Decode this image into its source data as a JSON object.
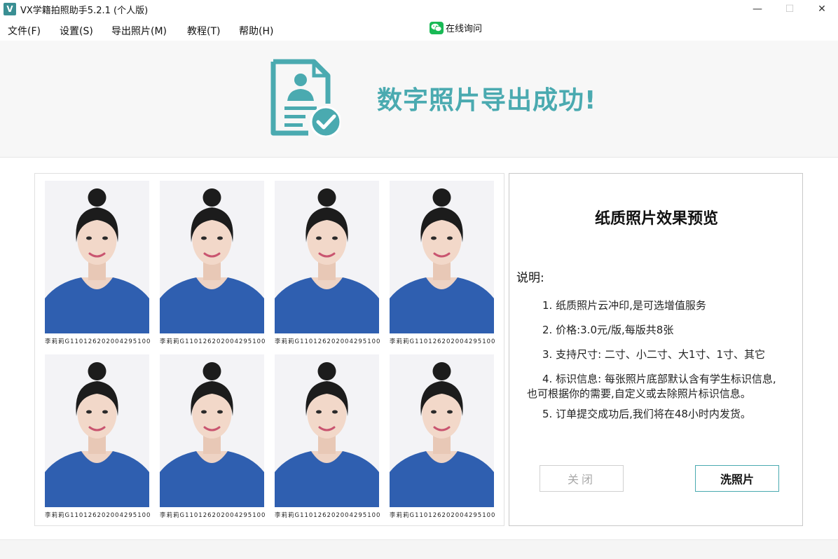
{
  "window": {
    "logo_text": "V",
    "title": "VX学籍拍照助手5.2.1 (个人版)",
    "minimize": "—",
    "maximize": "☐",
    "close": "✕"
  },
  "menu": {
    "items": [
      "文件(F)",
      "设置(S)",
      "导出照片(M)",
      "教程(T)",
      "帮助(H)"
    ],
    "online_label": "在线询问"
  },
  "banner": {
    "message": "数字照片导出成功!",
    "accent_color": "#4aaab0"
  },
  "photos": {
    "caption": "李莉莉G11012620200429510​0",
    "count": 8
  },
  "panel": {
    "title": "纸质照片效果预览",
    "desc_label": "说明:",
    "items": [
      "1. 纸质照片云冲印,是可选增值服务",
      "2. 价格:3.0元/版,每版共8张",
      "3. 支持尺寸: 二寸、小二寸、大1寸、1寸、其它",
      "4. 标识信息: 每张照片底部默认含有学生标识信息,",
      "也可根据你的需要,自定义或去除照片标识信息。",
      "5. 订单提交成功后,我们将在48小时内发货。"
    ],
    "close_button": "关闭",
    "print_button": "洗照片"
  }
}
